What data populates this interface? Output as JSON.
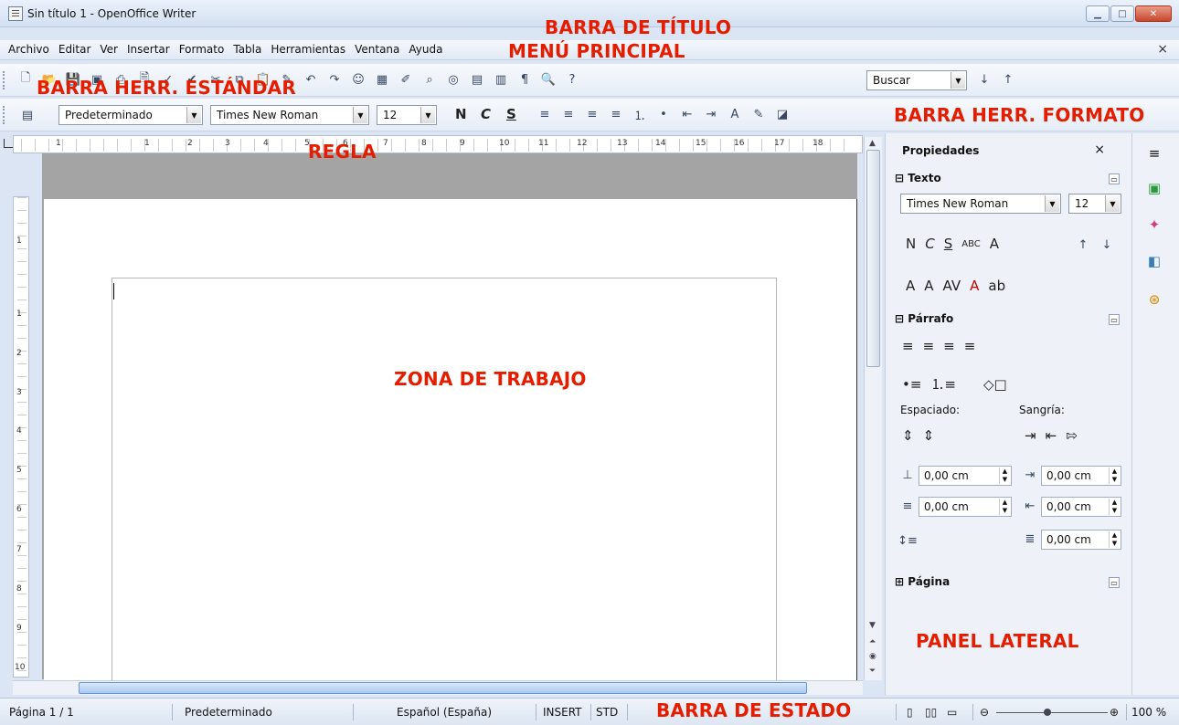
{
  "window": {
    "title": "Sin título 1 - OpenOffice Writer",
    "controls": [
      "minimize",
      "maximize",
      "close"
    ]
  },
  "menu": {
    "items": [
      "Archivo",
      "Editar",
      "Ver",
      "Insertar",
      "Formato",
      "Tabla",
      "Herramientas",
      "Ventana",
      "Ayuda"
    ],
    "close_label": "×"
  },
  "toolbar_standard": {
    "search_placeholder": "Buscar",
    "icons": [
      "new-icon",
      "open-icon",
      "save-icon",
      "pdf-icon",
      "print-icon",
      "preview-icon",
      "spellcheck-icon",
      "autospell-icon",
      "cut-icon",
      "copy-icon",
      "paste-icon",
      "format-paintbrush-icon",
      "undo-icon",
      "redo-icon",
      "gallery-icon",
      "table-icon",
      "draw-icon",
      "find-icon",
      "navigator-icon",
      "fields-icon",
      "database-icon",
      "paragraph-marks-icon",
      "zoom-icon",
      "help-icon"
    ]
  },
  "toolbar_format": {
    "style": "Predeterminado",
    "font": "Times New Roman",
    "size": "12",
    "buttons": {
      "bold": "N",
      "italic": "C",
      "underline": "S"
    }
  },
  "ruler": {
    "marks": [
      "1",
      "1",
      "2",
      "3",
      "4",
      "5",
      "6",
      "7",
      "8",
      "9",
      "10",
      "11",
      "12",
      "13",
      "14",
      "15",
      "16",
      "17",
      "18"
    ]
  },
  "vruler": {
    "marks": [
      "1",
      "1",
      "2",
      "3",
      "4",
      "5",
      "6",
      "7",
      "8",
      "9",
      "10"
    ]
  },
  "sidebar": {
    "title": "Propiedades",
    "close_label": "×",
    "texto": {
      "title": "Texto",
      "font": "Times New Roman",
      "size": "12",
      "row1": [
        "N",
        "C",
        "S",
        "ABC",
        "A"
      ],
      "row2": [
        "A",
        "A",
        "AV",
        "A",
        "ab"
      ]
    },
    "parrafo": {
      "title": "Párrafo",
      "espaciado_label": "Espaciado:",
      "sangria_label": "Sangría:",
      "fields": [
        "0,00 cm",
        "0,00 cm",
        "0,00 cm",
        "0,00 cm",
        "0,00 cm"
      ]
    },
    "pagina": {
      "title": "Página"
    }
  },
  "statusbar": {
    "page": "Página 1 / 1",
    "style": "Predeterminado",
    "language": "Español (España)",
    "insert": "INSERT",
    "selection": "STD",
    "zoom": "100 %",
    "zoom_minus": "⊖",
    "zoom_plus": "⊕"
  },
  "annotations": {
    "titlebar": "BARRA DE TÍTULO",
    "menu": "MENÚ PRINCIPAL",
    "toolbar_std": "BARRA HERR. ESTÁNDAR",
    "toolbar_fmt": "BARRA HERR. FORMATO",
    "ruler": "REGLA",
    "work": "ZONA DE TRABAJO",
    "panel": "PANEL LATERAL",
    "status": "BARRA DE ESTADO"
  },
  "colors": {
    "annotation": "#e41d00",
    "chrome": "#dbe5f3"
  }
}
